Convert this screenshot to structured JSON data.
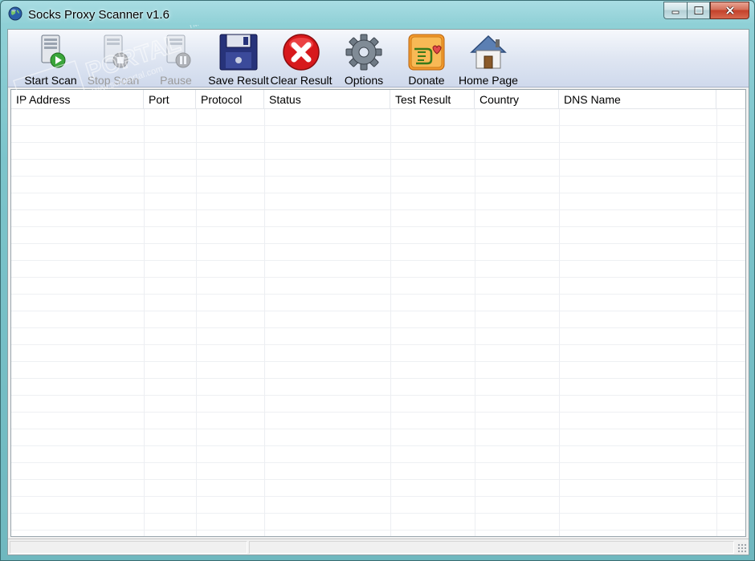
{
  "window": {
    "title": "Socks Proxy Scanner v1.6",
    "icon": "globe-icon",
    "caption": {
      "minimize": "minimize-icon",
      "maximize": "maximize-icon",
      "close": "close-icon"
    }
  },
  "toolbar": {
    "items": [
      {
        "label": "Start Scan",
        "icon": "start-scan-icon",
        "enabled": true
      },
      {
        "label": "Stop Scan",
        "icon": "stop-scan-icon",
        "enabled": false
      },
      {
        "label": "Pause",
        "icon": "pause-icon",
        "enabled": false
      },
      {
        "label": "Save Result",
        "icon": "floppy-disk-icon",
        "enabled": true
      },
      {
        "label": "Clear Result",
        "icon": "red-x-icon",
        "enabled": true
      },
      {
        "label": "Options",
        "icon": "gear-icon",
        "enabled": true
      },
      {
        "label": "Donate",
        "icon": "donate-hand-icon",
        "enabled": true
      },
      {
        "label": "Home Page",
        "icon": "house-icon",
        "enabled": true
      }
    ]
  },
  "table": {
    "columns": [
      "IP Address",
      "Port",
      "Protocol",
      "Status",
      "Test Result",
      "Country",
      "DNS Name"
    ],
    "rows": []
  },
  "watermark": {
    "text": "PORTAL",
    "url": "www.softportal.com",
    "mark": "TM"
  },
  "colors": {
    "accent": "#7fc6cc",
    "close": "#c4412a",
    "toolbar": "#dfe6f2"
  }
}
